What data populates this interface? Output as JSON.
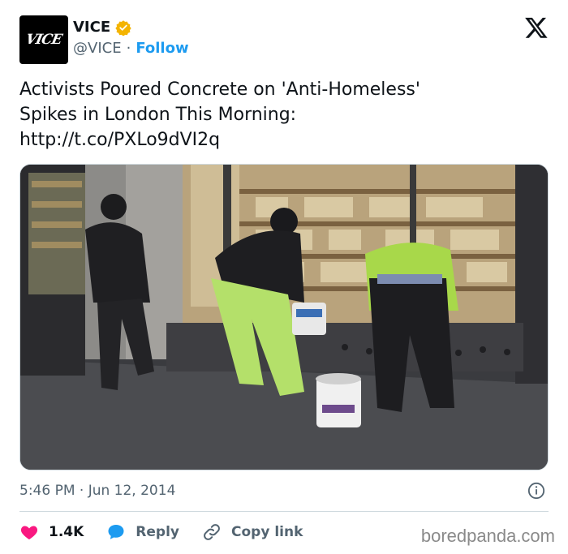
{
  "author": {
    "name": "VICE",
    "handle": "@VICE",
    "separator": "·",
    "follow_label": "Follow",
    "avatar_text": "VICE",
    "verified_color": "#f4b400"
  },
  "platform_icon": "x-logo-icon",
  "tweet": {
    "lines": [
      "Activists Poured Concrete on 'Anti-Homeless'",
      "Spikes in London This Morning:",
      "http://t.co/PXLo9dVI2q"
    ]
  },
  "meta": {
    "timestamp": "5:46 PM · Jun 12, 2014"
  },
  "actions": {
    "likes": "1.4K",
    "reply_label": "Reply",
    "copy_label": "Copy link"
  },
  "watermark": "boredpanda.com",
  "colors": {
    "like": "#f91880",
    "reply": "#1d9bf0",
    "link": "#1d9bf0",
    "text": "#0f1419",
    "muted": "#536471"
  }
}
